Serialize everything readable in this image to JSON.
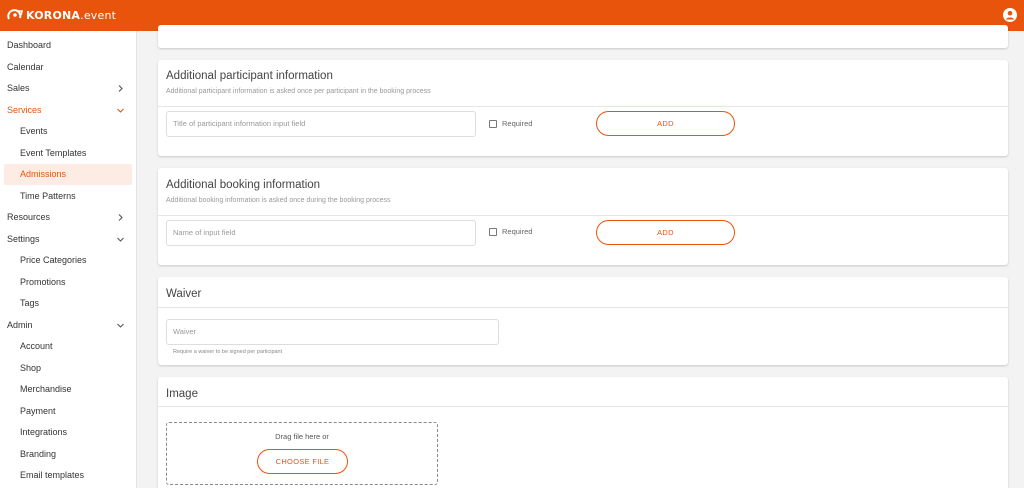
{
  "app": {
    "brand": "KORONA",
    "brand_suffix": ".event",
    "colors": {
      "accent": "#e8540c",
      "highlight_bg": "#fdece3"
    }
  },
  "sidebar": {
    "items": [
      {
        "label": "Dashboard"
      },
      {
        "label": "Calendar"
      },
      {
        "label": "Sales",
        "chevron": "right"
      },
      {
        "label": "Services",
        "chevron": "down",
        "active": true
      },
      {
        "label": "Events"
      },
      {
        "label": "Event Templates"
      },
      {
        "label": "Admissions",
        "selected": true
      },
      {
        "label": "Time Patterns"
      },
      {
        "label": "Resources",
        "chevron": "right"
      },
      {
        "label": "Settings",
        "chevron": "down"
      },
      {
        "label": "Price Categories"
      },
      {
        "label": "Promotions"
      },
      {
        "label": "Tags"
      },
      {
        "label": "Admin",
        "chevron": "down"
      },
      {
        "label": "Account"
      },
      {
        "label": "Shop"
      },
      {
        "label": "Merchandise"
      },
      {
        "label": "Payment"
      },
      {
        "label": "Integrations"
      },
      {
        "label": "Branding"
      },
      {
        "label": "Email templates"
      }
    ]
  },
  "participant_info": {
    "title": "Additional participant information",
    "subtitle": "Additional participant information is asked once per participant in the booking process",
    "input_placeholder": "Title of participant information input field",
    "required_label": "Required",
    "add_label": "ADD"
  },
  "booking_info": {
    "title": "Additional booking information",
    "subtitle": "Additional booking information is asked once during the booking process",
    "input_placeholder": "Name of input field",
    "required_label": "Required",
    "add_label": "ADD"
  },
  "waiver": {
    "title": "Waiver",
    "input_placeholder": "Waiver",
    "hint": "Require a waiver to be signed per participant"
  },
  "image": {
    "title": "Image",
    "drop_text": "Drag file here or",
    "choose_label": "CHOOSE FILE"
  }
}
